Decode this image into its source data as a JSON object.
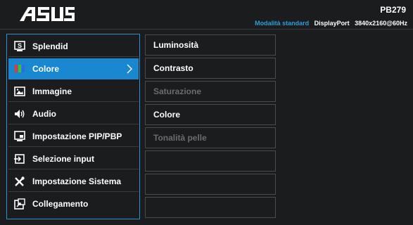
{
  "header": {
    "model": "PB279",
    "mode": "Modalità standard",
    "input": "DisplayPort",
    "resolution": "3840x2160@60Hz"
  },
  "colors": {
    "accent": "#1a88d1",
    "mode_text": "#2a9fd8",
    "disabled_text": "#6b6c6e"
  },
  "menu": {
    "items": [
      {
        "label": "Splendid",
        "icon": "splendid-s-icon"
      },
      {
        "label": "Colore",
        "icon": "color-bars-icon",
        "selected": true
      },
      {
        "label": "Immagine",
        "icon": "image-icon"
      },
      {
        "label": "Audio",
        "icon": "speaker-icon"
      },
      {
        "label": "Impostazione PIP/PBP",
        "icon": "pip-icon"
      },
      {
        "label": "Selezione input",
        "icon": "input-icon"
      },
      {
        "label": "Impostazione Sistema",
        "icon": "tools-icon"
      },
      {
        "label": "Collegamento",
        "icon": "shortcut-icon"
      }
    ]
  },
  "submenu": {
    "items": [
      {
        "label": "Luminosità",
        "enabled": true
      },
      {
        "label": "Contrasto",
        "enabled": true
      },
      {
        "label": "Saturazione",
        "enabled": false
      },
      {
        "label": "Colore",
        "enabled": true
      },
      {
        "label": "Tonalità pelle",
        "enabled": false
      },
      {
        "label": "",
        "enabled": false
      },
      {
        "label": "",
        "enabled": false
      },
      {
        "label": "",
        "enabled": false
      }
    ]
  }
}
